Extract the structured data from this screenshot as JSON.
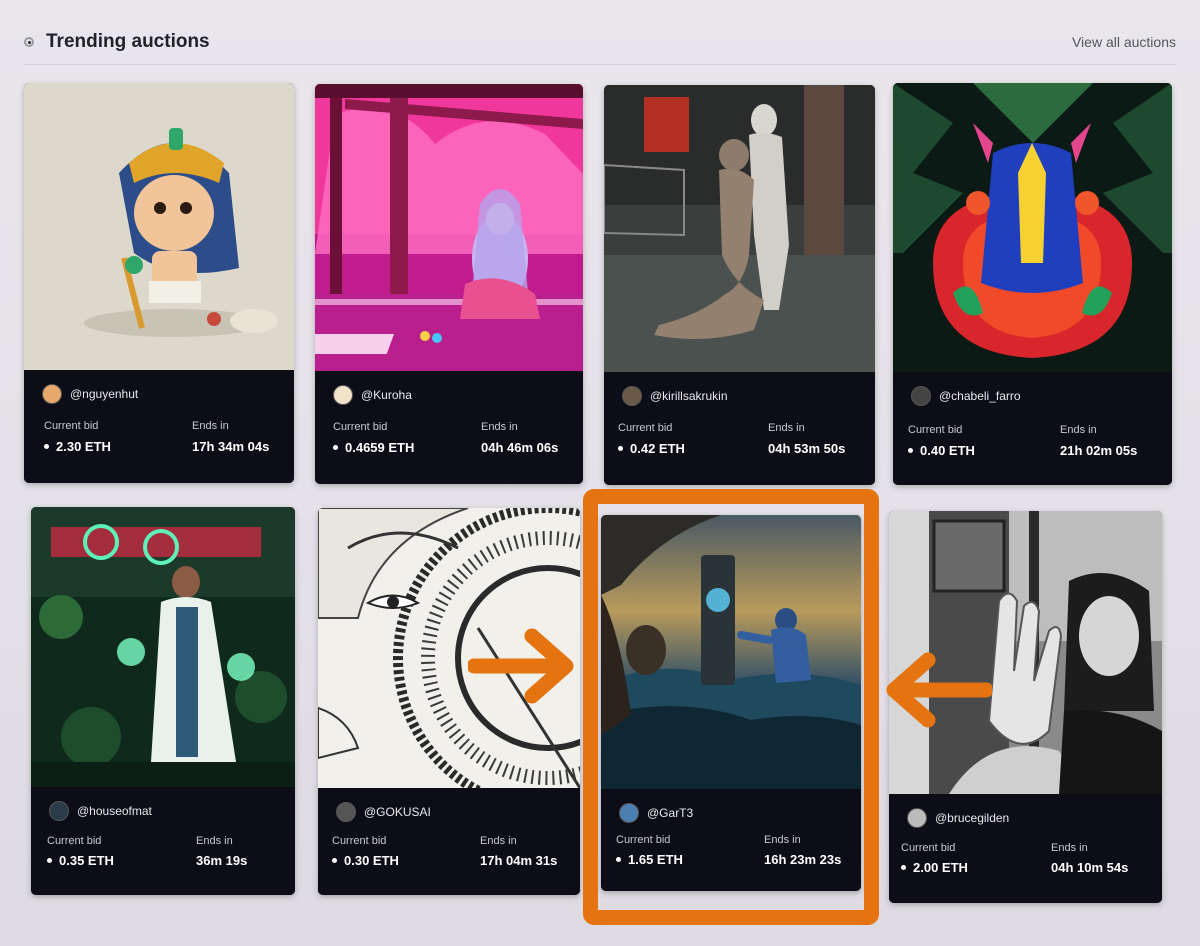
{
  "header": {
    "title": "Trending auctions",
    "view_all": "View all auctions"
  },
  "colors": {
    "accent": "#e57410",
    "card_bg": "#0d0d18"
  },
  "labels": {
    "current_bid": "Current bid",
    "ends_in": "Ends in"
  },
  "auctions": [
    {
      "handle": "@nguyenhut",
      "bid": "2.30 ETH",
      "ends": "17h 34m 04s"
    },
    {
      "handle": "@Kuroha",
      "bid": "0.4659 ETH",
      "ends": "04h 46m 06s"
    },
    {
      "handle": "@kirillsakrukin",
      "bid": "0.42 ETH",
      "ends": "04h 53m 50s"
    },
    {
      "handle": "@chabeli_farro",
      "bid": "0.40 ETH",
      "ends": "21h 02m 05s"
    },
    {
      "handle": "@houseofmat",
      "bid": "0.35 ETH",
      "ends": "36m 19s"
    },
    {
      "handle": "@GOKUSAI",
      "bid": "0.30 ETH",
      "ends": "17h 04m 31s"
    },
    {
      "handle": "@GarT3",
      "bid": "1.65 ETH",
      "ends": "16h 23m 23s"
    },
    {
      "handle": "@brucegilden",
      "bid": "2.00 ETH",
      "ends": "04h 10m 54s"
    }
  ]
}
